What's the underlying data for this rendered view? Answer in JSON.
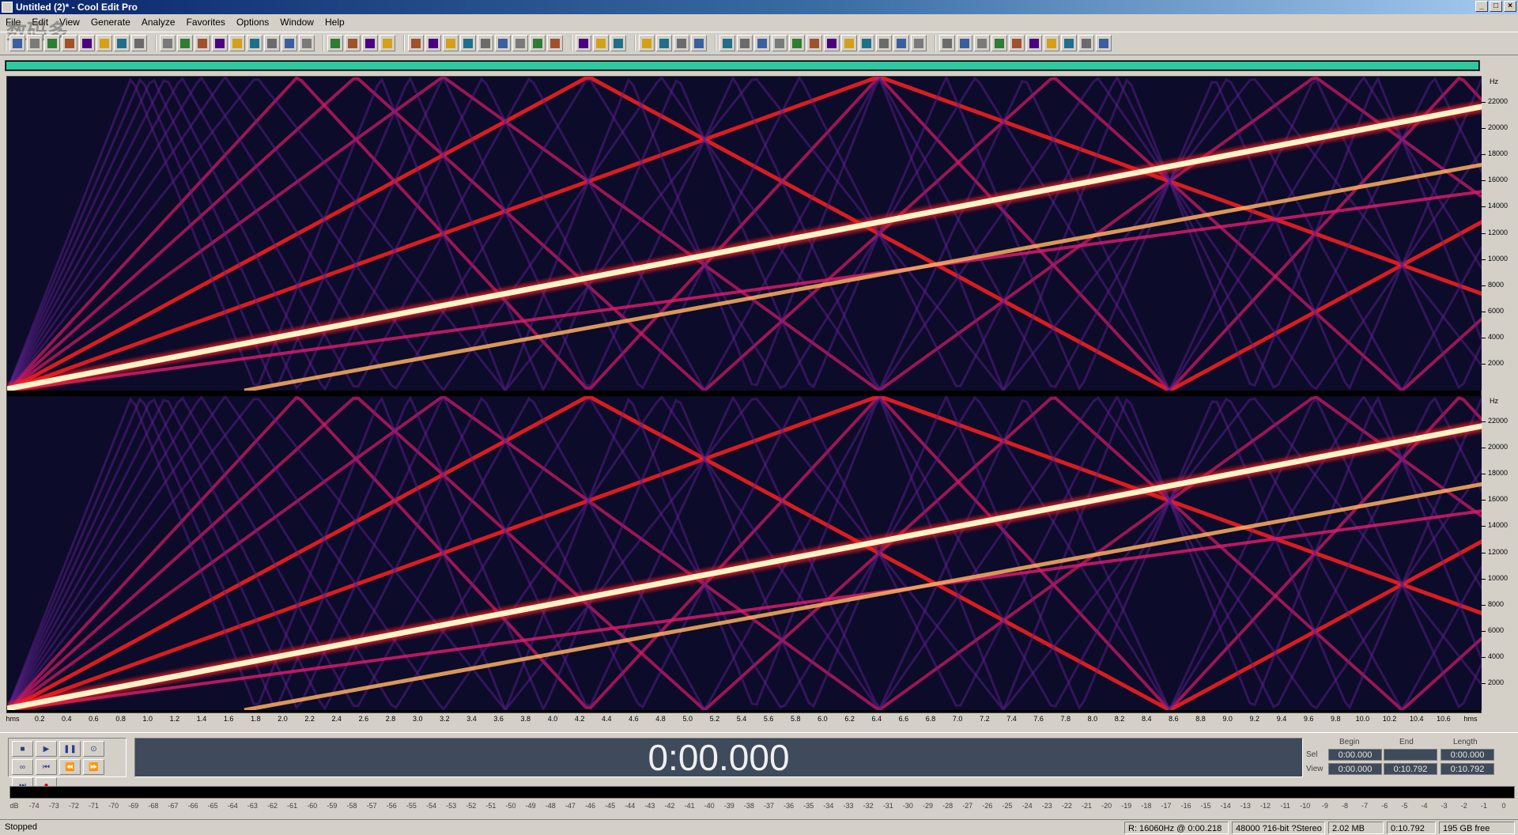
{
  "window": {
    "title": "Untitled (2)* - Cool Edit Pro",
    "controls": [
      "_",
      "□",
      "×"
    ]
  },
  "menu": [
    "File",
    "Edit",
    "View",
    "Generate",
    "Analyze",
    "Favorites",
    "Options",
    "Window",
    "Help"
  ],
  "watermark": "数码多",
  "spectral": {
    "hz_unit": "Hz",
    "hz_labels": [
      "22000",
      "20000",
      "18000",
      "16000",
      "14000",
      "12000",
      "10000",
      "8000",
      "6000",
      "4000",
      "2000"
    ],
    "colors": {
      "bg": "#0c0b2a",
      "low": "#5a1f8a",
      "mid": "#d81b6a",
      "high": "#ff2020",
      "peak": "#fff4c8"
    }
  },
  "time_ruler": {
    "labels": [
      "hms",
      "0.2",
      "0.4",
      "0.6",
      "0.8",
      "1.0",
      "1.2",
      "1.4",
      "1.6",
      "1.8",
      "2.0",
      "2.2",
      "2.4",
      "2.6",
      "2.8",
      "3.0",
      "3.2",
      "3.4",
      "3.6",
      "3.8",
      "4.0",
      "4.2",
      "4.4",
      "4.6",
      "4.8",
      "5.0",
      "5.2",
      "5.4",
      "5.6",
      "5.8",
      "6.0",
      "6.2",
      "6.4",
      "6.6",
      "6.8",
      "7.0",
      "7.2",
      "7.4",
      "7.6",
      "7.8",
      "8.0",
      "8.2",
      "8.4",
      "8.6",
      "8.8",
      "9.0",
      "9.2",
      "9.4",
      "9.6",
      "9.8",
      "10.0",
      "10.2",
      "10.4",
      "10.6",
      "hms"
    ]
  },
  "transport": {
    "time": "0:00.000",
    "buttons": [
      "stop",
      "play",
      "pause",
      "play-to-end",
      "loop",
      "go-start",
      "rewind",
      "fast-forward",
      "go-end",
      "record"
    ]
  },
  "selview": {
    "headers": [
      "Begin",
      "End",
      "Length"
    ],
    "rows": [
      {
        "label": "Sel",
        "begin": "0:00.000",
        "end": "",
        "length": "0:00.000"
      },
      {
        "label": "View",
        "begin": "0:00.000",
        "end": "0:10.792",
        "length": "0:10.792"
      }
    ]
  },
  "level_meter": {
    "labels": [
      "dB",
      "-74",
      "-73",
      "-72",
      "-71",
      "-70",
      "-69",
      "-68",
      "-67",
      "-66",
      "-65",
      "-64",
      "-63",
      "-62",
      "-61",
      "-60",
      "-59",
      "-58",
      "-57",
      "-56",
      "-55",
      "-54",
      "-53",
      "-52",
      "-51",
      "-50",
      "-49",
      "-48",
      "-47",
      "-46",
      "-45",
      "-44",
      "-43",
      "-42",
      "-41",
      "-40",
      "-39",
      "-38",
      "-37",
      "-36",
      "-35",
      "-34",
      "-33",
      "-32",
      "-31",
      "-30",
      "-29",
      "-28",
      "-27",
      "-26",
      "-25",
      "-24",
      "-23",
      "-22",
      "-21",
      "-20",
      "-19",
      "-18",
      "-17",
      "-16",
      "-15",
      "-14",
      "-13",
      "-12",
      "-11",
      "-10",
      "-9",
      "-8",
      "-7",
      "-6",
      "-5",
      "-4",
      "-3",
      "-2",
      "-1",
      "0"
    ]
  },
  "status": {
    "state": "Stopped",
    "cursor": "R: 16060Hz @  0:00.218",
    "format": "48000 ?16-bit ?Stereo",
    "size": "2.02 MB",
    "length": "0:10.792",
    "free": "195 GB free"
  }
}
